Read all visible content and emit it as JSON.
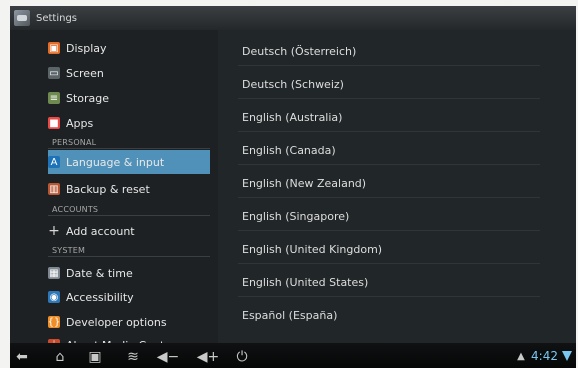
{
  "title": "Settings",
  "left_items": [
    {
      "label": "Display",
      "icon": "display-icon",
      "color": "#e36d28"
    },
    {
      "label": "Screen",
      "icon": "screen-icon",
      "color": "#5b6469"
    },
    {
      "label": "Storage",
      "icon": "storage-icon",
      "color": "#6e8a50"
    },
    {
      "label": "Apps",
      "icon": "apps-icon",
      "color": "#ea4a45"
    },
    {
      "label": "Language & input",
      "icon": "language-icon",
      "color": "#1e72b7"
    },
    {
      "label": "Backup & reset",
      "icon": "backup-reset-icon",
      "color": "#b85634"
    },
    {
      "label": "Add account",
      "icon": "add-icon",
      "color": "#d8d8d8"
    },
    {
      "label": "Date & time",
      "icon": "calendar-icon",
      "color": "#7f8891"
    },
    {
      "label": "Accessibility",
      "icon": "accessibility-icon",
      "color": "#2e78ba"
    },
    {
      "label": "Developer options",
      "icon": "developer-options-icon",
      "color": "#ef8e28"
    },
    {
      "label": "About Media Center",
      "icon": "info-icon",
      "color": "#cc4b2c"
    }
  ],
  "sections": [
    "PERSONAL",
    "ACCOUNTS",
    "SYSTEM"
  ],
  "languages": [
    "Deutsch (Österreich)",
    "Deutsch (Schweiz)",
    "English (Australia)",
    "English (Canada)",
    "English (New Zealand)",
    "English (Singapore)",
    "English (United Kingdom)",
    "English (United States)",
    "Español (España)"
  ],
  "status": {
    "time": "4:42"
  },
  "nav_icons": [
    "back-icon",
    "home-icon",
    "recent-apps-icon",
    "menu-icon",
    "volume-down-icon",
    "volume-up-icon",
    "power-icon"
  ]
}
